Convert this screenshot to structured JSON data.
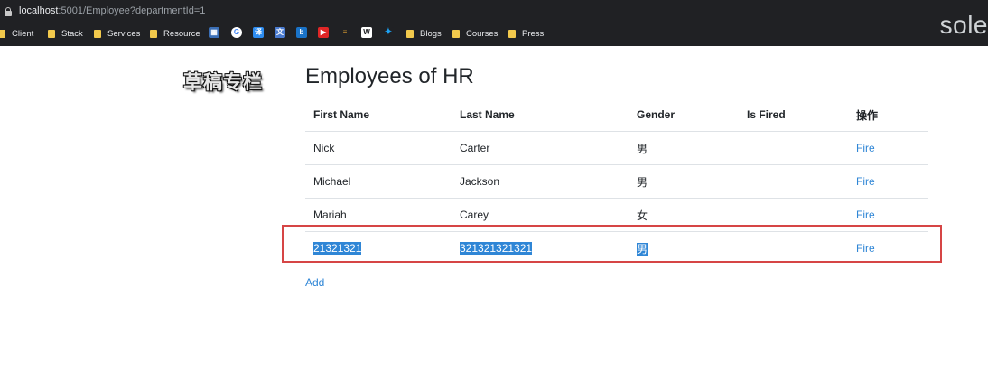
{
  "browser": {
    "url_host": "localhost",
    "url_rest": ":5001/Employee?departmentId=1",
    "bookmarks": [
      "Client",
      "Stack",
      "Services",
      "Resource",
      "Blogs",
      "Courses",
      "Press"
    ],
    "corner_text": "sole"
  },
  "logo_text": "草稿专栏",
  "page_title": "Employees of HR",
  "table": {
    "headers": [
      "First Name",
      "Last Name",
      "Gender",
      "Is Fired",
      "操作"
    ],
    "rows": [
      {
        "first": "Nick",
        "last": "Carter",
        "gender": "男",
        "fired": "",
        "action": "Fire"
      },
      {
        "first": "Michael",
        "last": "Jackson",
        "gender": "男",
        "fired": "",
        "action": "Fire"
      },
      {
        "first": "Mariah",
        "last": "Carey",
        "gender": "女",
        "fired": "",
        "action": "Fire"
      },
      {
        "first": "21321321",
        "last": "321321321321",
        "gender": "男",
        "fired": "",
        "action": "Fire"
      }
    ]
  },
  "add_label": "Add"
}
